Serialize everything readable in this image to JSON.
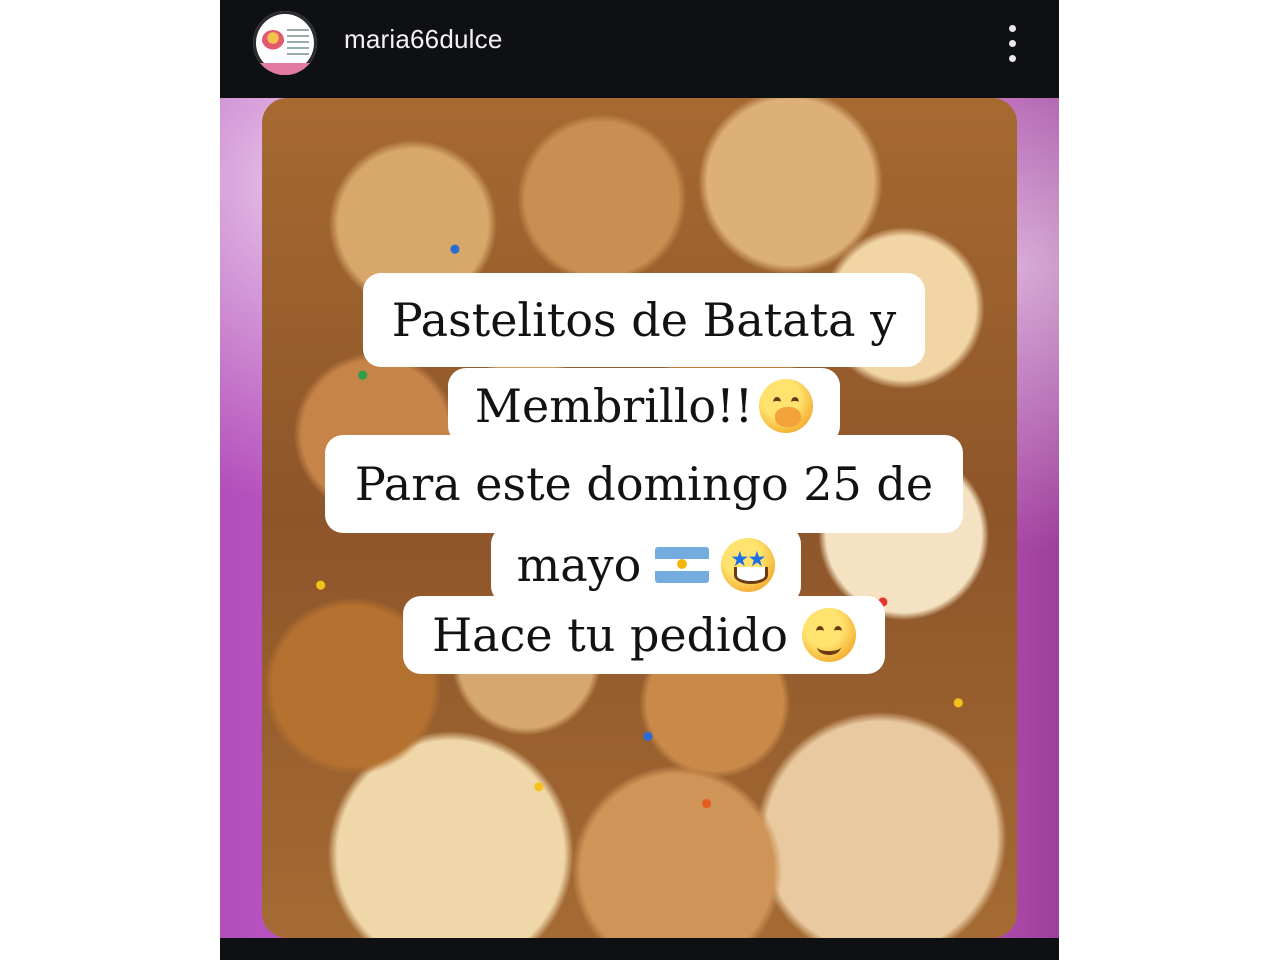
{
  "post": {
    "username": "maria66dulce",
    "avatar_icon": "bakery-logo-icon",
    "more_icon": "more-options-icon"
  },
  "caption": {
    "line1": "Pastelitos de Batata y",
    "line2": "Membrillo!!",
    "line3": "Para este domingo 25 de",
    "line4": "mayo",
    "line5": "Hace tu pedido"
  },
  "emoji": {
    "line2": "hand-over-mouth-emoji",
    "line4_flag": "argentina-flag-emoji",
    "line4_face": "star-struck-emoji",
    "line5": "smiling-face-emoji"
  },
  "colors": {
    "header_background": "#0f1014",
    "caption_background": "#ffffff",
    "caption_text": "#121212",
    "tissue_pink": "#c05bc6"
  }
}
